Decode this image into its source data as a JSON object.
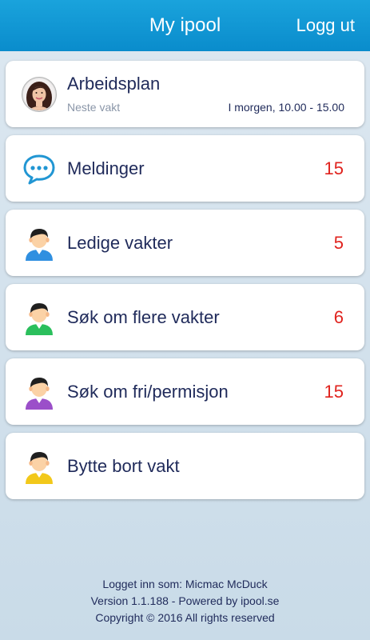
{
  "header": {
    "title": "My ipool",
    "logout_label": "Logg ut"
  },
  "workplan": {
    "label": "Arbeidsplan",
    "next_shift_label": "Neste vakt",
    "next_shift_time": "I morgen, 10.00 - 15.00"
  },
  "menu": [
    {
      "label": "Meldinger",
      "count": "15",
      "icon": "chat-bubble-icon"
    },
    {
      "label": "Ledige vakter",
      "count": "5",
      "icon": "person-blue-icon"
    },
    {
      "label": "Søk om flere vakter",
      "count": "6",
      "icon": "person-green-icon"
    },
    {
      "label": "Søk om fri/permisjon",
      "count": "15",
      "icon": "person-purple-icon"
    },
    {
      "label": "Bytte bort vakt",
      "count": "",
      "icon": "person-yellow-icon"
    }
  ],
  "footer": {
    "logged_in": "Logget inn som: Micmac McDuck",
    "version": "Version 1.1.188 - Powered by ipool.se",
    "copyright": "Copyright © 2016 All rights reserved"
  },
  "colors": {
    "header": "#0a8ccc",
    "count": "#e0231e",
    "text": "#1f2a5a",
    "background": "#d3e1ec"
  }
}
